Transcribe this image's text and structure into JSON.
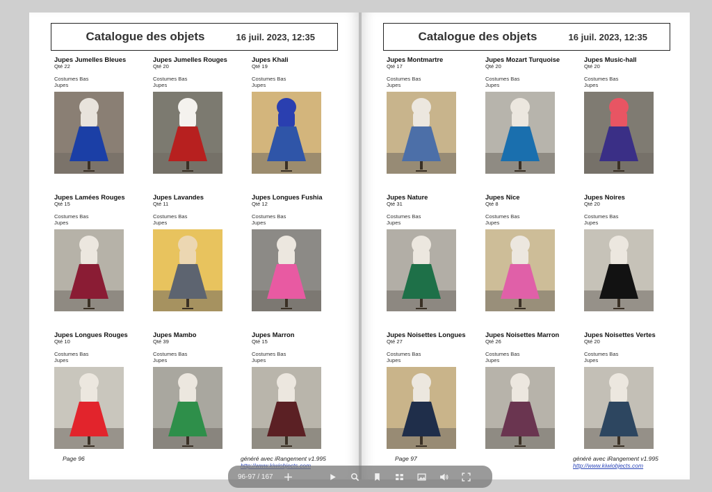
{
  "left_page": {
    "header": {
      "title": "Catalogue des objets",
      "date": "16 juil. 2023, 12:35"
    },
    "items": [
      {
        "name": "Jupes Jumelles Bleues",
        "qty": "Qté 22",
        "category": "Costumes Bas",
        "subcategory": "Jupes",
        "skirt_color": "#1b3fa6",
        "bg": "#8a7f74",
        "top": "#e8e3dc"
      },
      {
        "name": "Jupes Jumelles Rouges",
        "qty": "Qté 20",
        "category": "Costumes Bas",
        "subcategory": "Jupes",
        "skirt_color": "#b7201f",
        "bg": "#7c7a70",
        "top": "#f4f2ee"
      },
      {
        "name": "Jupes Khali",
        "qty": "Qté 19",
        "category": "Costumes Bas",
        "subcategory": "Jupes",
        "skirt_color": "#2f55a8",
        "bg": "#d3b57c",
        "top": "#2a3fb0"
      },
      {
        "name": "Jupes Lamées Rouges",
        "qty": "Qté 15",
        "category": "Costumes Bas",
        "subcategory": "Jupes",
        "skirt_color": "#8a1c34",
        "bg": "#b6b2a8",
        "top": "#ece7df"
      },
      {
        "name": "Jupes Lavandes",
        "qty": "Qté 11",
        "category": "Costumes Bas",
        "subcategory": "Jupes",
        "skirt_color": "#5d6470",
        "bg": "#e8c35e",
        "top": "#ecd7b2"
      },
      {
        "name": "Jupes Longues Fushia",
        "qty": "Qté 12",
        "category": "Costumes Bas",
        "subcategory": "Jupes",
        "skirt_color": "#e85aa2",
        "bg": "#8c8a86",
        "top": "#ece7df"
      },
      {
        "name": "Jupes Longues Rouges",
        "qty": "Qté 10",
        "category": "Costumes Bas",
        "subcategory": "Jupes",
        "skirt_color": "#e2242c",
        "bg": "#c9c6bd",
        "top": "#ece7df"
      },
      {
        "name": "Jupes Mambo",
        "qty": "Qté 39",
        "category": "Costumes Bas",
        "subcategory": "Jupes",
        "skirt_color": "#2e8f4a",
        "bg": "#a9a79f",
        "top": "#ece7df"
      },
      {
        "name": "Jupes Marron",
        "qty": "Qté 15",
        "category": "Costumes Bas",
        "subcategory": "Jupes",
        "skirt_color": "#5b2024",
        "bg": "#b9b5ab",
        "top": "#ece7df"
      }
    ],
    "footer_page": "Page 96",
    "footer_gen": "généré avec iRangement v1.995",
    "footer_link": "http://www.kiwiobjects.com"
  },
  "right_page": {
    "header": {
      "title": "Catalogue des objets",
      "date": "16 juil. 2023, 12:35"
    },
    "items": [
      {
        "name": "Jupes Montmartre",
        "qty": "Qté 17",
        "category": "Costumes Bas",
        "subcategory": "Jupes",
        "skirt_color": "#4c6fa8",
        "bg": "#c8b48c",
        "top": "#ece7df"
      },
      {
        "name": "Jupes Mozart Turquoise",
        "qty": "Qté 20",
        "category": "Costumes Bas",
        "subcategory": "Jupes",
        "skirt_color": "#1a6fae",
        "bg": "#b7b4ac",
        "top": "#ece7df"
      },
      {
        "name": "Jupes Music-hall",
        "qty": "Qté 20",
        "category": "Costumes Bas",
        "subcategory": "Jupes",
        "skirt_color": "#3a2f86",
        "bg": "#7f7b72",
        "top": "#e85563"
      },
      {
        "name": "Jupes Nature",
        "qty": "Qté 31",
        "category": "Costumes Bas",
        "subcategory": "Jupes",
        "skirt_color": "#1e7048",
        "bg": "#b2aea6",
        "top": "#ece7df"
      },
      {
        "name": "Jupes Nice",
        "qty": "Qté 8",
        "category": "Costumes Bas",
        "subcategory": "Jupes",
        "skirt_color": "#e060a8",
        "bg": "#cdbd98",
        "top": "#ece7df"
      },
      {
        "name": "Jupes Noires",
        "qty": "Qté 20",
        "category": "Costumes Bas",
        "subcategory": "Jupes",
        "skirt_color": "#121212",
        "bg": "#c6c2b8",
        "top": "#ece7df"
      },
      {
        "name": "Jupes Noisettes Longues",
        "qty": "Qté 27",
        "category": "Costumes Bas",
        "subcategory": "Jupes",
        "skirt_color": "#1f2e4a",
        "bg": "#c9b48a",
        "top": "#ece7df"
      },
      {
        "name": "Jupes Noisettes Marron",
        "qty": "Qté 26",
        "category": "Costumes Bas",
        "subcategory": "Jupes",
        "skirt_color": "#6a3550",
        "bg": "#b7b3aa",
        "top": "#ece7df"
      },
      {
        "name": "Jupes Noisettes Vertes",
        "qty": "Qté 20",
        "category": "Costumes Bas",
        "subcategory": "Jupes",
        "skirt_color": "#2d4660",
        "bg": "#c3bfb6",
        "top": "#ece7df"
      }
    ],
    "footer_page": "Page 97",
    "footer_gen": "généré avec iRangement v1.995",
    "footer_link": "http://www.kiwiobjects.com"
  },
  "toolbar": {
    "page_indicator": "96-97 / 167",
    "icons": [
      "zoom-in-icon",
      "play-icon",
      "search-icon",
      "bookmark-icon",
      "thumbnails-icon",
      "image-icon",
      "volume-icon",
      "fullscreen-icon"
    ]
  }
}
